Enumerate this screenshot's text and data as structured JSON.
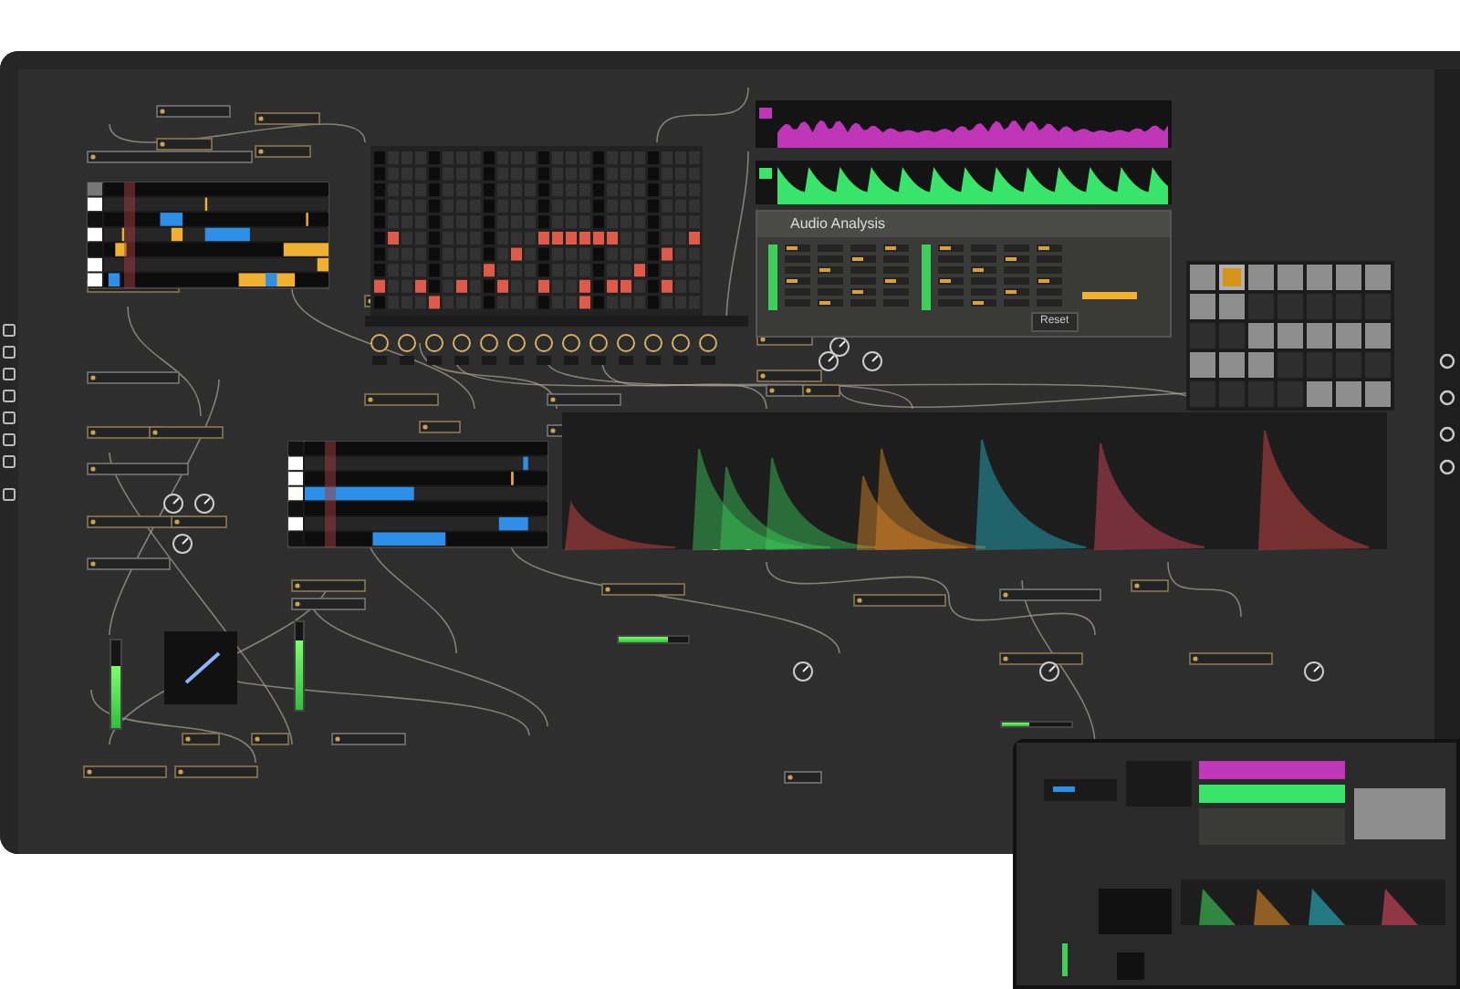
{
  "analysis_panel": {
    "title": "Audio Analysis",
    "reset_button": "Reset"
  },
  "meters": [
    {
      "kind": "vertical",
      "level": 0.7
    },
    {
      "kind": "vertical",
      "level": 0.8
    },
    {
      "kind": "horizontal",
      "level": 0.72
    },
    {
      "kind": "horizontal",
      "level": 0.4
    }
  ],
  "pad_grid": {
    "rows": [
      {
        "pads": [
          {
            "on": true,
            "selected": false
          },
          {
            "on": true,
            "selected": true
          },
          {
            "on": true,
            "selected": false
          },
          {
            "on": true,
            "selected": false
          },
          {
            "on": true,
            "selected": false
          },
          {
            "on": true,
            "selected": false
          },
          {
            "on": true,
            "selected": false
          }
        ]
      },
      {
        "pads": [
          {
            "on": true,
            "selected": false
          },
          {
            "on": true,
            "selected": false
          },
          {
            "on": false,
            "selected": false
          },
          {
            "on": false,
            "selected": false
          },
          {
            "on": false,
            "selected": false
          },
          {
            "on": false,
            "selected": false
          },
          {
            "on": false,
            "selected": false
          }
        ]
      },
      {
        "pads": [
          {
            "on": false,
            "selected": false
          },
          {
            "on": false,
            "selected": false
          },
          {
            "on": true,
            "selected": false
          },
          {
            "on": true,
            "selected": false
          },
          {
            "on": true,
            "selected": false
          },
          {
            "on": true,
            "selected": false
          },
          {
            "on": true,
            "selected": false
          }
        ]
      },
      {
        "pads": [
          {
            "on": true,
            "selected": false
          },
          {
            "on": true,
            "selected": false
          },
          {
            "on": true,
            "selected": false
          },
          {
            "on": false,
            "selected": false
          },
          {
            "on": false,
            "selected": false
          },
          {
            "on": false,
            "selected": false
          },
          {
            "on": false,
            "selected": false
          }
        ]
      },
      {
        "pads": [
          {
            "on": false,
            "selected": false
          },
          {
            "on": false,
            "selected": false
          },
          {
            "on": false,
            "selected": false
          },
          {
            "on": false,
            "selected": false
          },
          {
            "on": true,
            "selected": false
          },
          {
            "on": true,
            "selected": false
          },
          {
            "on": true,
            "selected": false
          }
        ]
      }
    ]
  }
}
